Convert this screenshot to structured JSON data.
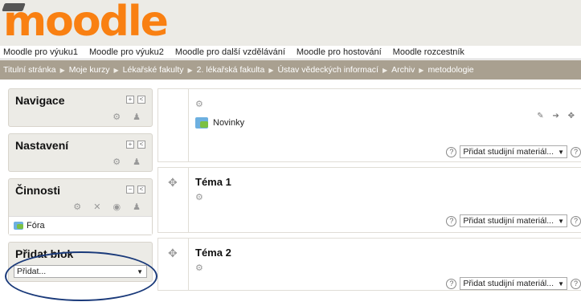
{
  "logo": {
    "text": "moodle"
  },
  "custommenu": [
    "Moodle pro výuku1",
    "Moodle pro výuku2",
    "Moodle pro další vzdělávání",
    "Moodle pro hostování",
    "Moodle rozcestník"
  ],
  "breadcrumb": [
    "Titulní stránka",
    "Moje kurzy",
    "Lékařské fakulty",
    "2. lékařská fakulta",
    "Ústav vědeckých informací",
    "Archiv",
    "metodologie"
  ],
  "blocks": {
    "navigace": {
      "title": "Navigace"
    },
    "nastaveni": {
      "title": "Nastavení"
    },
    "cinnosti": {
      "title": "Činnosti",
      "item": "Fóra"
    },
    "pridat": {
      "title": "Přidat blok",
      "select_value": "Přidat..."
    }
  },
  "sections": {
    "s0": {
      "activity": "Novinky"
    },
    "s1": {
      "title": "Téma 1"
    },
    "s2": {
      "title": "Téma 2"
    }
  },
  "add_resource": {
    "label": "Přidat studijní materiál..."
  },
  "icons": {
    "gear": "⚙",
    "move": "✥",
    "help": "?"
  }
}
